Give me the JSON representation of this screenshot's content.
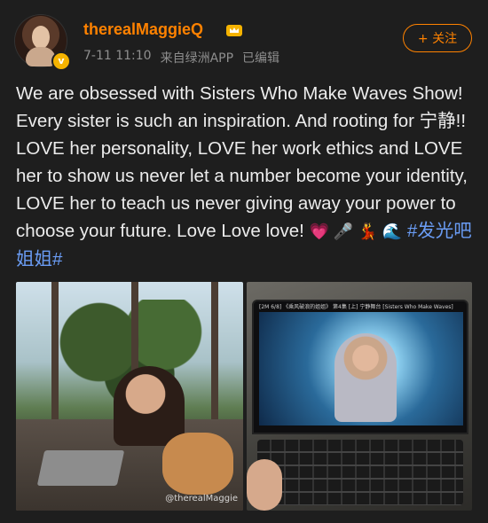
{
  "post": {
    "username": "therealMaggieQ",
    "timestamp": "7-11 11:10",
    "source": "来自绿洲APP",
    "edited": "已编辑",
    "follow_label": "+ 关注",
    "text_main": "We are obsessed with Sisters Who Make Waves Show! Every sister is such an inspiration. And rooting for 宁静!! LOVE her personality, LOVE her work ethics and LOVE her to show us never let a number become your identity, LOVE her to teach us never giving away your power to choose your future. Love Love love!",
    "emojis": "💗 🎤 💃 🌊",
    "hashtag": "#发光吧姐姐#"
  },
  "photos": {
    "left_watermark": "@therealMaggie",
    "screen_header": "[2M 6/8] 《乘风破浪的姐姐》 第4集 [上] 宁静舞台 [Sisters Who Make Waves]"
  },
  "colors": {
    "username": "#ff8200",
    "hashtag": "#6a9cf4",
    "background": "#1e1e1e",
    "meta": "#8e8e8e"
  },
  "icons": {
    "verified": "verified-badge-icon",
    "crown": "crown-icon"
  }
}
